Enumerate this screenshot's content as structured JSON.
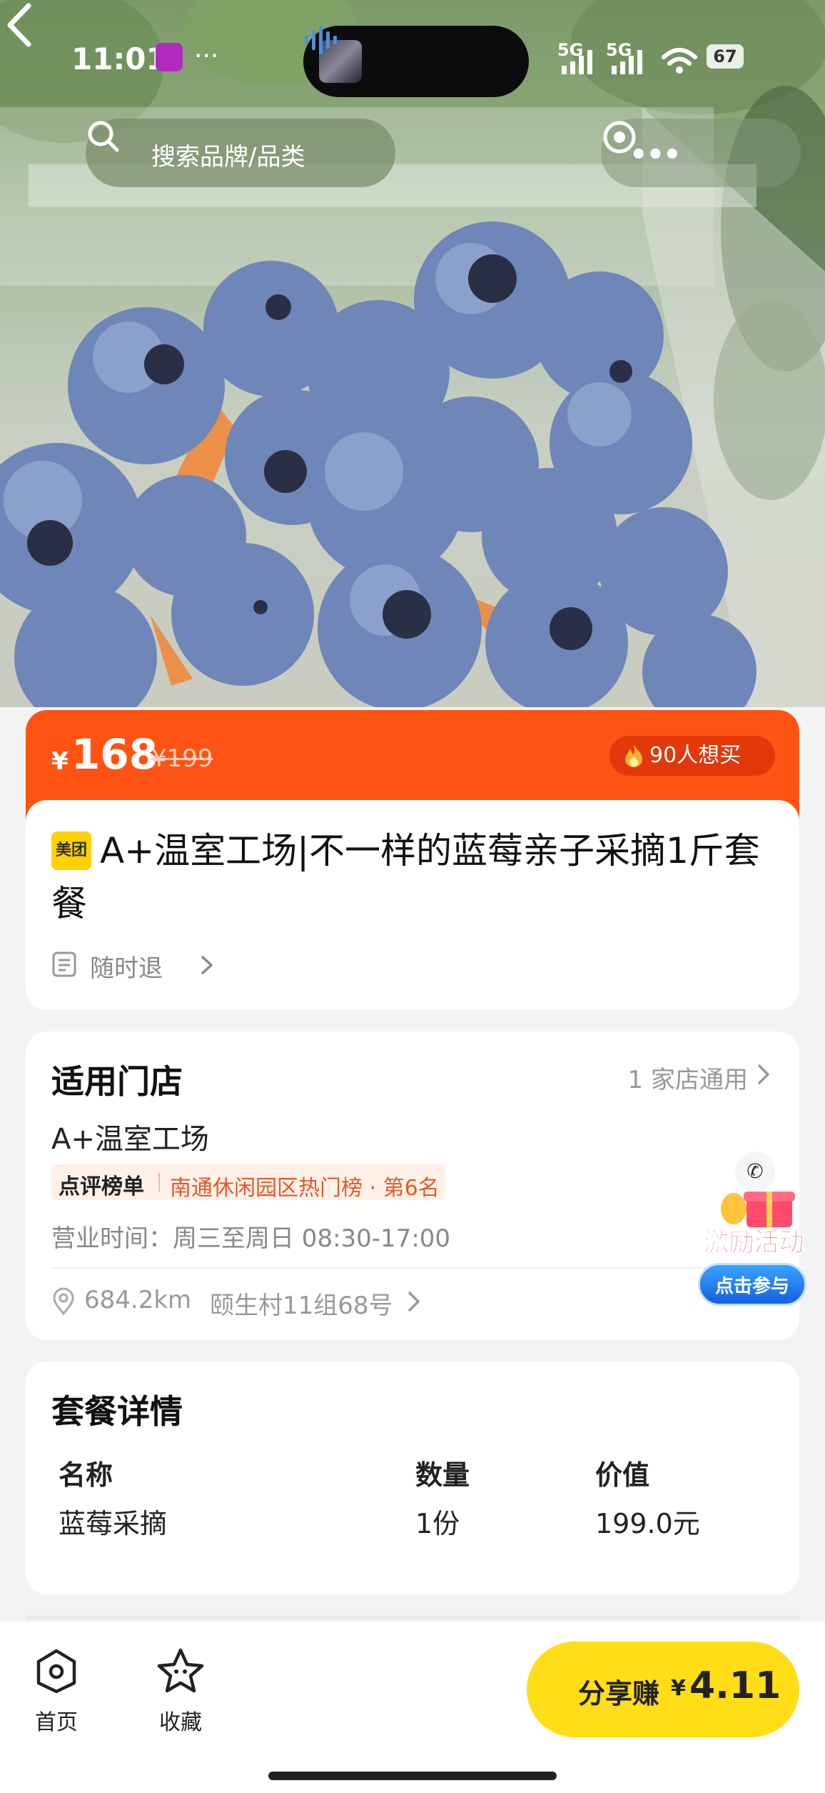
{
  "status_bar": {
    "time": "11:01",
    "more_dots": "···",
    "signal_1": "5G",
    "signal_2": "5G",
    "battery": "67"
  },
  "nav": {
    "search_placeholder": "搜索品牌/品类",
    "capsule_more": "•••"
  },
  "price": {
    "currency": "¥",
    "current": "168",
    "original": "¥199",
    "want_count": "90人想买"
  },
  "product": {
    "brand_badge": "美团",
    "title": "A+温室工场|不一样的蓝莓亲子采摘1斤套餐",
    "refund_policy": "随时退"
  },
  "store": {
    "section_title": "适用门店",
    "store_count": "1 家店通用",
    "name": "A+温室工场",
    "rank_logo": "点评榜单",
    "rank_text": "南通休闲园区热门榜 · 第6名",
    "hours": "营业时间：周三至周日 08:30-17:00",
    "distance": "684.2km",
    "address": "颐生村11组68号"
  },
  "activity": {
    "title": "激励活动",
    "button": "点击参与"
  },
  "package": {
    "section_title": "套餐详情",
    "headers": [
      "名称",
      "数量",
      "价值"
    ],
    "rows": [
      [
        "蓝莓采摘",
        "1份",
        "199.0元"
      ]
    ]
  },
  "bottom_bar": {
    "home_label": "首页",
    "fav_label": "收藏",
    "share_label": "分享赚",
    "share_currency": "¥",
    "share_amount": "4.11"
  },
  "colors": {
    "price_bar": "#ff5313",
    "share_button": "#ffde17",
    "rank_text": "#e0592a"
  }
}
